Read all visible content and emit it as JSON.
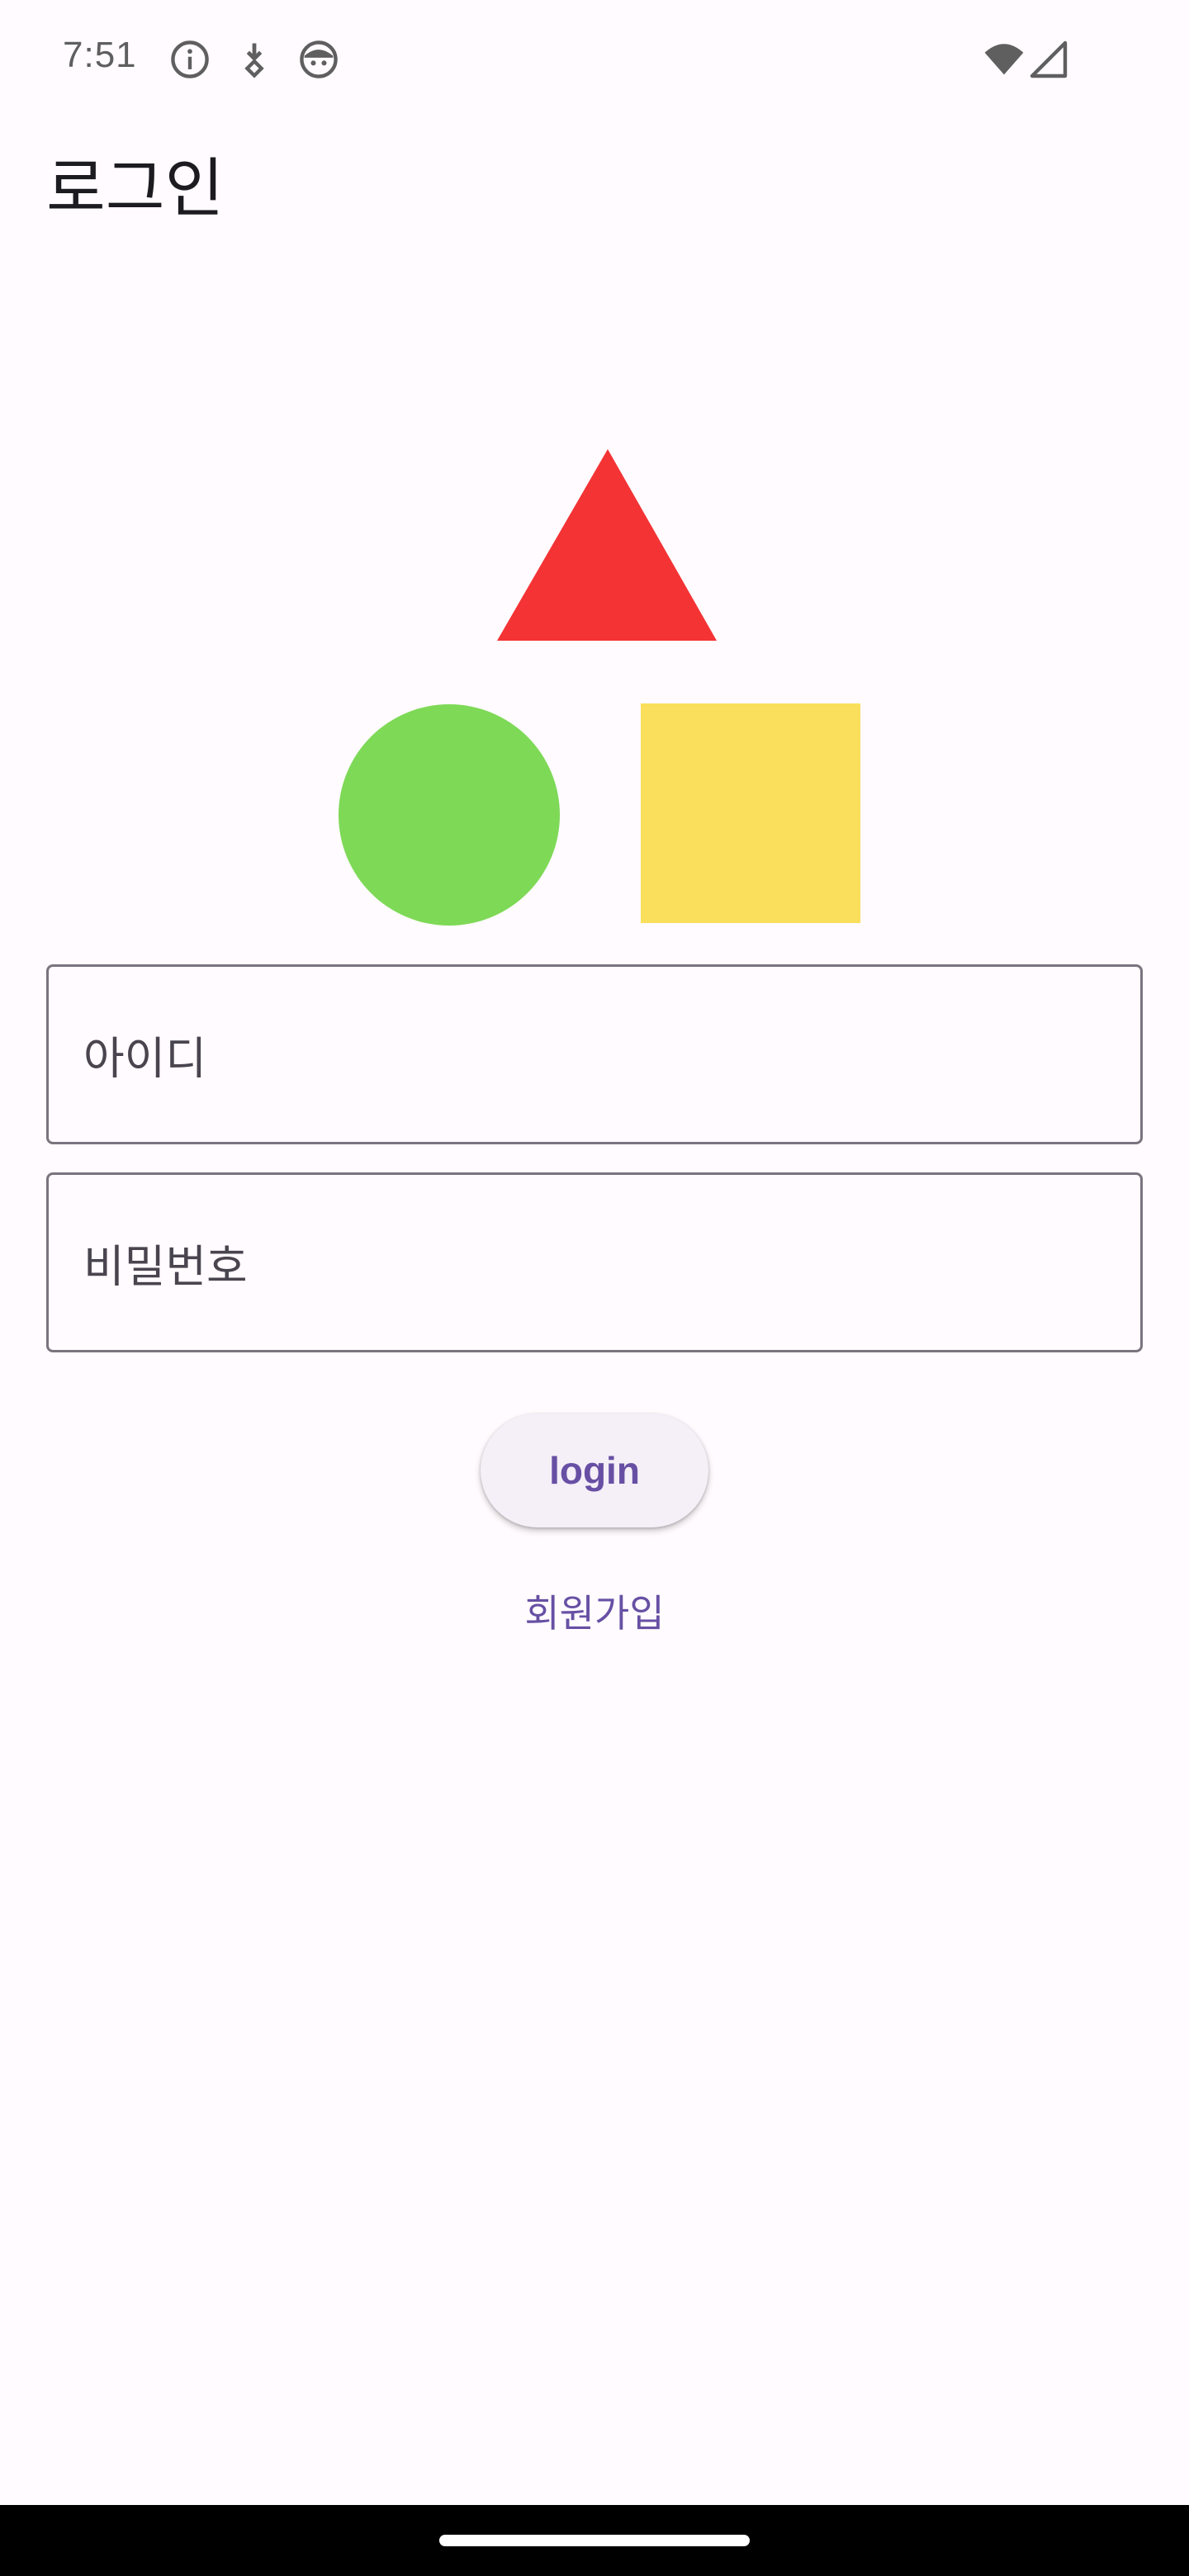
{
  "status_bar": {
    "time": "7:51",
    "left_icons": [
      "info-icon",
      "download-icon",
      "face-icon"
    ],
    "right_icons": [
      "wifi-icon",
      "cellular-signal-icon"
    ]
  },
  "app_bar": {
    "title": "로그인"
  },
  "shapes": {
    "triangle_color": "#f43335",
    "circle_color": "#7ed957",
    "square_color": "#f9df5c"
  },
  "form": {
    "id_label": "아이디",
    "password_label": "비밀번호"
  },
  "actions": {
    "login_label": "login",
    "signup_label": "회원가입"
  },
  "colors": {
    "background": "#fffbfe",
    "primary": "#6750a4",
    "button_surface": "#f5eff7",
    "field_outline": "#79747e"
  }
}
